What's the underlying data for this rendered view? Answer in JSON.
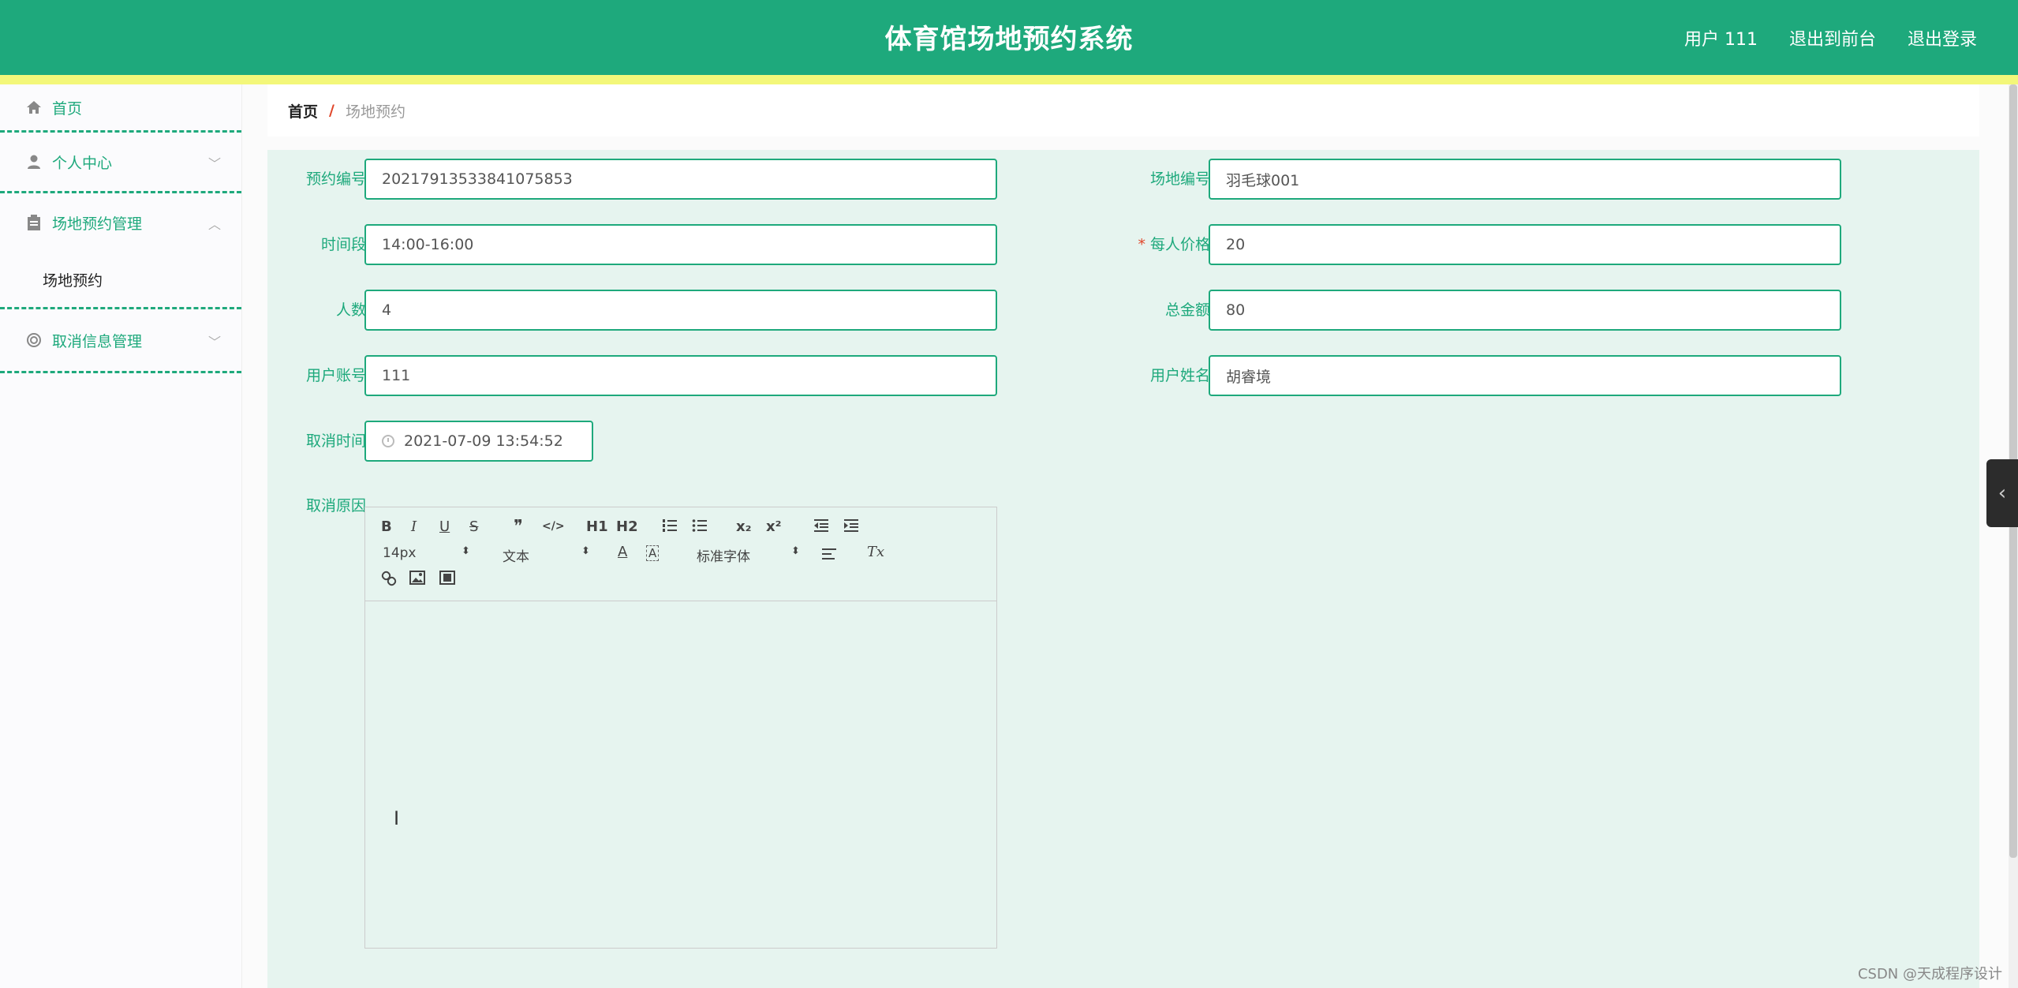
{
  "header": {
    "title": "体育馆场地预约系统",
    "links": [
      "用户 111",
      "退出到前台",
      "退出登录"
    ]
  },
  "sidebar": {
    "home": "首页",
    "personal": "个人中心",
    "booking_mgmt": "场地预约管理",
    "booking_sub": "场地预约",
    "cancel_mgmt": "取消信息管理"
  },
  "breadcrumb": {
    "home": "首页",
    "separator": "/",
    "current": "场地预约"
  },
  "form": {
    "booking_no": {
      "label": "预约编号",
      "value": "20217913533841075853"
    },
    "venue_no": {
      "label": "场地编号",
      "value": "羽毛球001"
    },
    "time_slot": {
      "label": "时间段",
      "value": "14:00-16:00"
    },
    "price": {
      "label": "每人价格",
      "required_mark": "*",
      "value": "20"
    },
    "people": {
      "label": "人数",
      "value": "4"
    },
    "total": {
      "label": "总金额",
      "value": "80"
    },
    "account": {
      "label": "用户账号",
      "value": "111"
    },
    "user_name": {
      "label": "用户姓名",
      "value": "胡睿境"
    },
    "cancel_time": {
      "label": "取消时间",
      "value": "2021-07-09 13:54:52"
    },
    "cancel_reason": {
      "label": "取消原因"
    }
  },
  "editor": {
    "buttons_row1": [
      "B",
      "I",
      "U",
      "S",
      "❞",
      "</>",
      "H1",
      "H2",
      "ol",
      "ul",
      "x₂",
      "x²",
      "outdent",
      "indent"
    ],
    "font_size": "14px",
    "header_select": "文本",
    "font_family": "标准字体",
    "clean_label": "Tx"
  },
  "watermark": "CSDN @天成程序设计"
}
